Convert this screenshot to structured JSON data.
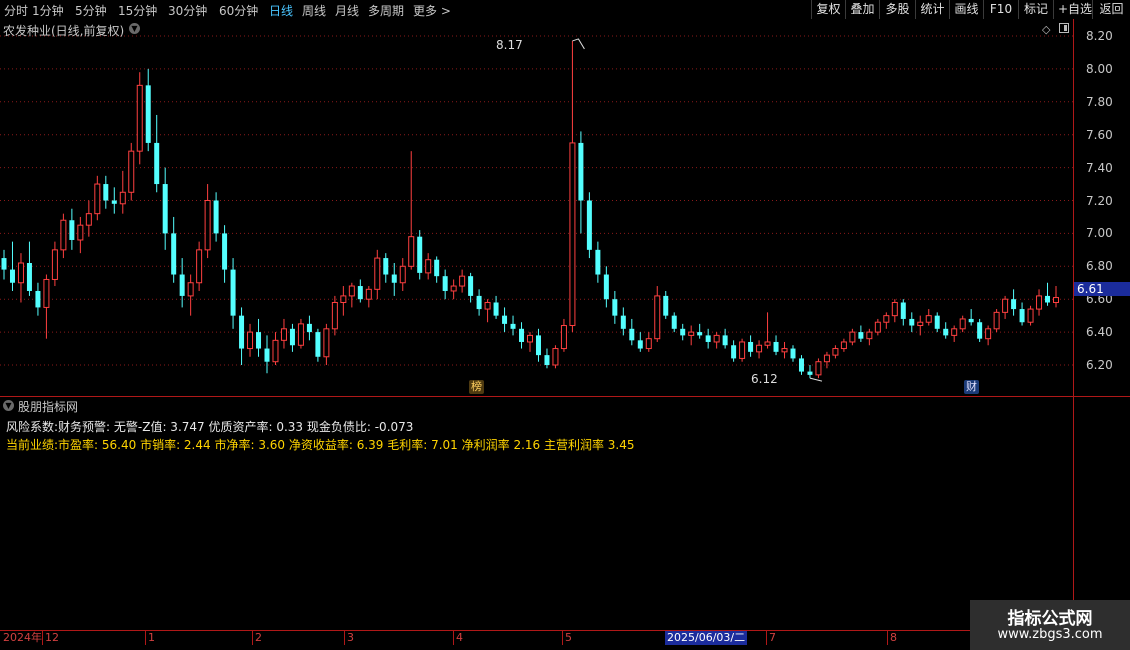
{
  "toolbar": {
    "periods": [
      "分时",
      "1分钟",
      "5分钟",
      "15分钟",
      "30分钟",
      "60分钟",
      "日线",
      "周线",
      "月线",
      "多周期",
      "更多 >"
    ],
    "active_period": "日线",
    "buttons": [
      "复权",
      "叠加",
      "多股",
      "统计",
      "画线",
      "F10",
      "标记",
      "+自选",
      "返回"
    ]
  },
  "chart": {
    "title": "农发种业(日线,前复权)",
    "price_ticks": [
      "8.20",
      "8.00",
      "7.80",
      "7.60",
      "7.40",
      "7.20",
      "7.00",
      "6.80",
      "6.60",
      "6.40",
      "6.20"
    ],
    "current_price": "6.61",
    "high_label": "8.17",
    "low_label": "6.12",
    "event_badges": [
      "榜",
      "财"
    ],
    "colors": {
      "up": "#ff4040",
      "down": "#54ffff",
      "grid": "#8a1a1a",
      "frame": "#b01818"
    }
  },
  "indicator": {
    "title": "股朋指标网",
    "risk_line": "风险系数:财务预警: 无警-Z值: 3.747 优质资产率: 0.33 现金负债比: -0.073",
    "perf_line": "当前业绩:市盈率: 56.40 市销率: 2.44 市净率: 3.60 净资收益率: 6.39 毛利率: 7.01 净利润率 2.16 主营利润率 3.45"
  },
  "date_axis": {
    "ticks": [
      "2024年",
      "12",
      "1",
      "2",
      "3",
      "4",
      "5",
      "7",
      "8"
    ],
    "cursor_date": "2025/06/03/二"
  },
  "watermark": {
    "title": "指标公式网",
    "url": "www.zbgs3.com"
  },
  "chart_data": {
    "type": "candlestick",
    "title": "农发种业(日线,前复权)",
    "y_range": [
      6.12,
      8.2
    ],
    "candles_ohlc": [
      [
        6.85,
        6.9,
        6.72,
        6.78
      ],
      [
        6.78,
        6.95,
        6.65,
        6.7
      ],
      [
        6.7,
        6.88,
        6.58,
        6.82
      ],
      [
        6.82,
        6.95,
        6.62,
        6.65
      ],
      [
        6.65,
        6.7,
        6.5,
        6.55
      ],
      [
        6.55,
        6.75,
        6.36,
        6.72
      ],
      [
        6.72,
        6.95,
        6.68,
        6.9
      ],
      [
        6.9,
        7.12,
        6.85,
        7.08
      ],
      [
        7.08,
        7.15,
        6.9,
        6.96
      ],
      [
        6.96,
        7.1,
        6.88,
        7.05
      ],
      [
        7.05,
        7.2,
        6.98,
        7.12
      ],
      [
        7.12,
        7.35,
        7.08,
        7.3
      ],
      [
        7.3,
        7.35,
        7.15,
        7.2
      ],
      [
        7.2,
        7.28,
        7.12,
        7.18
      ],
      [
        7.18,
        7.38,
        7.12,
        7.25
      ],
      [
        7.25,
        7.55,
        7.2,
        7.5
      ],
      [
        7.5,
        7.98,
        7.42,
        7.9
      ],
      [
        7.9,
        8.0,
        7.5,
        7.55
      ],
      [
        7.55,
        7.72,
        7.25,
        7.3
      ],
      [
        7.3,
        7.4,
        6.9,
        7.0
      ],
      [
        7.0,
        7.1,
        6.7,
        6.75
      ],
      [
        6.75,
        6.85,
        6.55,
        6.62
      ],
      [
        6.62,
        6.75,
        6.5,
        6.7
      ],
      [
        6.7,
        6.95,
        6.65,
        6.9
      ],
      [
        6.9,
        7.3,
        6.85,
        7.2
      ],
      [
        7.2,
        7.25,
        6.95,
        7.0
      ],
      [
        7.0,
        7.05,
        6.7,
        6.78
      ],
      [
        6.78,
        6.85,
        6.42,
        6.5
      ],
      [
        6.5,
        6.55,
        6.2,
        6.3
      ],
      [
        6.3,
        6.45,
        6.25,
        6.4
      ],
      [
        6.4,
        6.48,
        6.25,
        6.3
      ],
      [
        6.3,
        6.38,
        6.15,
        6.22
      ],
      [
        6.22,
        6.4,
        6.2,
        6.35
      ],
      [
        6.35,
        6.48,
        6.3,
        6.42
      ],
      [
        6.42,
        6.45,
        6.28,
        6.32
      ],
      [
        6.32,
        6.48,
        6.3,
        6.45
      ],
      [
        6.45,
        6.5,
        6.35,
        6.4
      ],
      [
        6.4,
        6.42,
        6.22,
        6.25
      ],
      [
        6.25,
        6.45,
        6.2,
        6.42
      ],
      [
        6.42,
        6.62,
        6.38,
        6.58
      ],
      [
        6.58,
        6.68,
        6.5,
        6.62
      ],
      [
        6.62,
        6.7,
        6.55,
        6.68
      ],
      [
        6.68,
        6.72,
        6.58,
        6.6
      ],
      [
        6.6,
        6.68,
        6.55,
        6.66
      ],
      [
        6.66,
        6.9,
        6.6,
        6.85
      ],
      [
        6.85,
        6.88,
        6.7,
        6.75
      ],
      [
        6.75,
        6.82,
        6.62,
        6.7
      ],
      [
        6.7,
        6.85,
        6.65,
        6.8
      ],
      [
        6.8,
        7.5,
        6.78,
        6.98
      ],
      [
        6.98,
        7.02,
        6.72,
        6.76
      ],
      [
        6.76,
        6.88,
        6.72,
        6.84
      ],
      [
        6.84,
        6.86,
        6.7,
        6.74
      ],
      [
        6.74,
        6.78,
        6.6,
        6.65
      ],
      [
        6.65,
        6.72,
        6.6,
        6.68
      ],
      [
        6.68,
        6.78,
        6.64,
        6.74
      ],
      [
        6.74,
        6.76,
        6.58,
        6.62
      ],
      [
        6.62,
        6.66,
        6.5,
        6.54
      ],
      [
        6.54,
        6.6,
        6.46,
        6.58
      ],
      [
        6.58,
        6.62,
        6.48,
        6.5
      ],
      [
        6.5,
        6.55,
        6.4,
        6.45
      ],
      [
        6.45,
        6.5,
        6.38,
        6.42
      ],
      [
        6.42,
        6.46,
        6.3,
        6.34
      ],
      [
        6.34,
        6.4,
        6.28,
        6.38
      ],
      [
        6.38,
        6.42,
        6.22,
        6.26
      ],
      [
        6.26,
        6.3,
        6.18,
        6.2
      ],
      [
        6.2,
        6.32,
        6.18,
        6.3
      ],
      [
        6.3,
        6.48,
        6.28,
        6.44
      ],
      [
        6.44,
        8.17,
        6.4,
        7.55
      ],
      [
        7.55,
        7.62,
        7.0,
        7.2
      ],
      [
        7.2,
        7.25,
        6.85,
        6.9
      ],
      [
        6.9,
        6.95,
        6.7,
        6.75
      ],
      [
        6.75,
        6.8,
        6.55,
        6.6
      ],
      [
        6.6,
        6.65,
        6.45,
        6.5
      ],
      [
        6.5,
        6.55,
        6.38,
        6.42
      ],
      [
        6.42,
        6.48,
        6.32,
        6.35
      ],
      [
        6.35,
        6.4,
        6.28,
        6.3
      ],
      [
        6.3,
        6.4,
        6.28,
        6.36
      ],
      [
        6.36,
        6.68,
        6.34,
        6.62
      ],
      [
        6.62,
        6.65,
        6.48,
        6.5
      ],
      [
        6.5,
        6.52,
        6.4,
        6.42
      ],
      [
        6.42,
        6.45,
        6.35,
        6.38
      ],
      [
        6.38,
        6.44,
        6.32,
        6.4
      ],
      [
        6.4,
        6.45,
        6.36,
        6.38
      ],
      [
        6.38,
        6.42,
        6.3,
        6.34
      ],
      [
        6.34,
        6.4,
        6.3,
        6.38
      ],
      [
        6.38,
        6.42,
        6.3,
        6.32
      ],
      [
        6.32,
        6.35,
        6.22,
        6.24
      ],
      [
        6.24,
        6.36,
        6.22,
        6.34
      ],
      [
        6.34,
        6.38,
        6.25,
        6.28
      ],
      [
        6.28,
        6.35,
        6.24,
        6.32
      ],
      [
        6.32,
        6.52,
        6.3,
        6.34
      ],
      [
        6.34,
        6.38,
        6.26,
        6.28
      ],
      [
        6.28,
        6.34,
        6.24,
        6.3
      ],
      [
        6.3,
        6.32,
        6.22,
        6.24
      ],
      [
        6.24,
        6.26,
        6.14,
        6.16
      ],
      [
        6.16,
        6.2,
        6.12,
        6.14
      ],
      [
        6.14,
        6.24,
        6.12,
        6.22
      ],
      [
        6.22,
        6.28,
        6.18,
        6.26
      ],
      [
        6.26,
        6.32,
        6.24,
        6.3
      ],
      [
        6.3,
        6.36,
        6.28,
        6.34
      ],
      [
        6.34,
        6.42,
        6.32,
        6.4
      ],
      [
        6.4,
        6.44,
        6.34,
        6.36
      ],
      [
        6.36,
        6.42,
        6.32,
        6.4
      ],
      [
        6.4,
        6.48,
        6.38,
        6.46
      ],
      [
        6.46,
        6.52,
        6.42,
        6.5
      ],
      [
        6.5,
        6.6,
        6.46,
        6.58
      ],
      [
        6.58,
        6.6,
        6.44,
        6.48
      ],
      [
        6.48,
        6.52,
        6.4,
        6.44
      ],
      [
        6.44,
        6.5,
        6.38,
        6.46
      ],
      [
        6.46,
        6.54,
        6.44,
        6.5
      ],
      [
        6.5,
        6.52,
        6.4,
        6.42
      ],
      [
        6.42,
        6.46,
        6.36,
        6.38
      ],
      [
        6.38,
        6.44,
        6.34,
        6.42
      ],
      [
        6.42,
        6.5,
        6.4,
        6.48
      ],
      [
        6.48,
        6.54,
        6.44,
        6.46
      ],
      [
        6.46,
        6.48,
        6.34,
        6.36
      ],
      [
        6.36,
        6.44,
        6.32,
        6.42
      ],
      [
        6.42,
        6.54,
        6.4,
        6.52
      ],
      [
        6.52,
        6.62,
        6.48,
        6.6
      ],
      [
        6.6,
        6.66,
        6.5,
        6.54
      ],
      [
        6.54,
        6.58,
        6.44,
        6.46
      ],
      [
        6.46,
        6.56,
        6.44,
        6.54
      ],
      [
        6.54,
        6.66,
        6.5,
        6.62
      ],
      [
        6.62,
        6.7,
        6.56,
        6.58
      ],
      [
        6.58,
        6.68,
        6.55,
        6.61
      ]
    ]
  }
}
